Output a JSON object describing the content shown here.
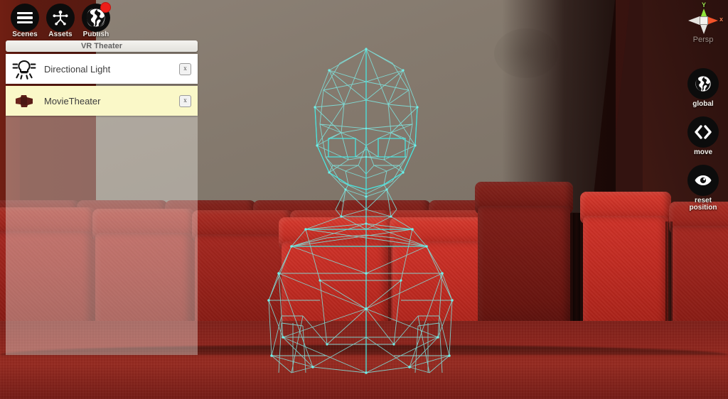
{
  "app": {
    "scene_title": "VR Theater"
  },
  "toolbar": {
    "items": [
      {
        "label": "Scenes",
        "icon": "hamburger-menu-icon",
        "badge": false
      },
      {
        "label": "Assets",
        "icon": "avatar-figure-icon",
        "badge": false
      },
      {
        "label": "Publish",
        "icon": "globe-icon",
        "badge": true
      }
    ]
  },
  "outliner": {
    "items": [
      {
        "name": "Directional Light",
        "icon": "light-bulb-icon",
        "close_label": "x",
        "selected": false
      },
      {
        "name": "MovieTheater",
        "icon": "theater-model-icon",
        "close_label": "x",
        "selected": true
      }
    ]
  },
  "gizmo": {
    "axis_y_label": "Y",
    "axis_x_label": "x",
    "projection_label": "Persp",
    "color_y": "#8ee33a",
    "color_x": "#f2532a",
    "color_neutral": "#e6e4e0"
  },
  "right_toolbar": {
    "buttons": [
      {
        "label": "global",
        "icon": "globe-icon"
      },
      {
        "label": "move",
        "icon": "move-arrows-icon"
      },
      {
        "label": "reset\nposition",
        "label_line1": "reset",
        "label_line2": "position",
        "icon": "eye-icon"
      }
    ]
  },
  "viewport": {
    "scene_objects": "wireframe-avatar, movie-screen, theater-seats",
    "wireframe_color": "#6ff0ea",
    "screen_color": "#857a6e",
    "seat_color": "#c42d23",
    "wall_color": "#4f1810",
    "floor_color": "#952a20"
  }
}
